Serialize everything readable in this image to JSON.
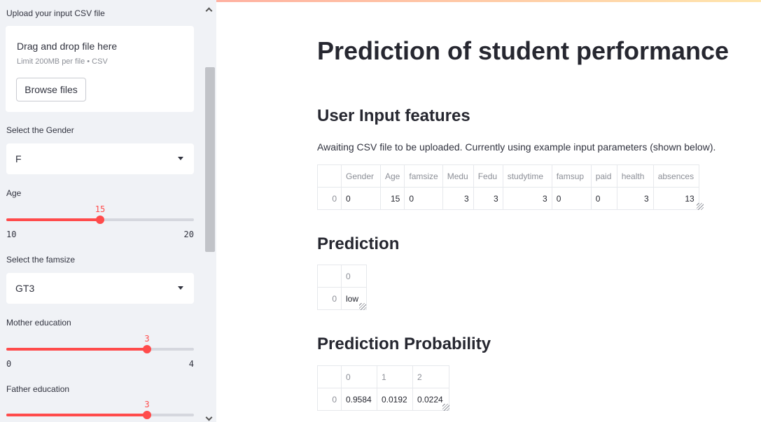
{
  "sidebar": {
    "upload_label": "Upload your input CSV file",
    "drop_title": "Drag and drop file here",
    "drop_limit": "Limit 200MB per file • CSV",
    "browse_label": "Browse files",
    "gender": {
      "label": "Select the Gender",
      "value": "F"
    },
    "age": {
      "label": "Age",
      "value": "15",
      "min": "10",
      "max": "20",
      "fraction": 0.5
    },
    "famsize": {
      "label": "Select the famsize",
      "value": "GT3"
    },
    "medu": {
      "label": "Mother education",
      "value": "3",
      "min": "0",
      "max": "4",
      "fraction": 0.75
    },
    "fedu": {
      "label": "Father education",
      "value": "3",
      "fraction": 0.75
    }
  },
  "main": {
    "title": "Prediction of student performance",
    "features_heading": "User Input features",
    "info_text": "Awaiting CSV file to be uploaded. Currently using example input parameters (shown below).",
    "features_table": {
      "columns": [
        "",
        "Gender",
        "Age",
        "famsize",
        "Medu",
        "Fedu",
        "studytime",
        "famsup",
        "paid",
        "health",
        "absences"
      ],
      "row": [
        "0",
        "0",
        "15",
        "0",
        "3",
        "3",
        "3",
        "0",
        "0",
        "3",
        "13"
      ]
    },
    "prediction_heading": "Prediction",
    "prediction_table": {
      "columns": [
        "",
        "0"
      ],
      "row": [
        "0",
        "low"
      ]
    },
    "probability_heading": "Prediction Probability",
    "probability_table": {
      "columns": [
        "",
        "0",
        "1",
        "2"
      ],
      "row": [
        "0",
        "0.9584",
        "0.0192",
        "0.0224"
      ]
    }
  },
  "colors": {
    "accent": "#ff4b4b",
    "sidebar_bg": "#f0f2f6"
  },
  "icons": {
    "select_caret": "chevron-down-icon",
    "resize": "resize-handle-icon"
  }
}
